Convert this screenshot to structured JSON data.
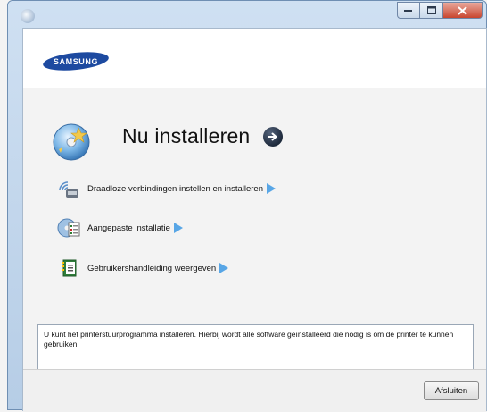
{
  "window": {
    "controls": {
      "minimize": "minimize",
      "maximize": "maximize",
      "close": "close"
    }
  },
  "brand": {
    "logo_text": "SAMSUNG",
    "color": "#1d4aa0"
  },
  "main": {
    "title": "Nu installeren",
    "options": [
      {
        "label": "Draadloze verbindingen instellen en installeren",
        "icon": "wireless-icon"
      },
      {
        "label": "Aangepaste installatie",
        "icon": "custom-install-icon"
      },
      {
        "label": "Gebruikershandleiding weergeven",
        "icon": "user-manual-icon"
      }
    ],
    "description": "U kunt het printerstuurprogramma installeren. Hierbij wordt alle software geïnstalleerd die nodig is om de printer te kunnen gebruiken."
  },
  "footer": {
    "close_label": "Afsluiten"
  },
  "colors": {
    "accent_arrow": "#58a6e6",
    "go_button": "#1e2a3c"
  }
}
